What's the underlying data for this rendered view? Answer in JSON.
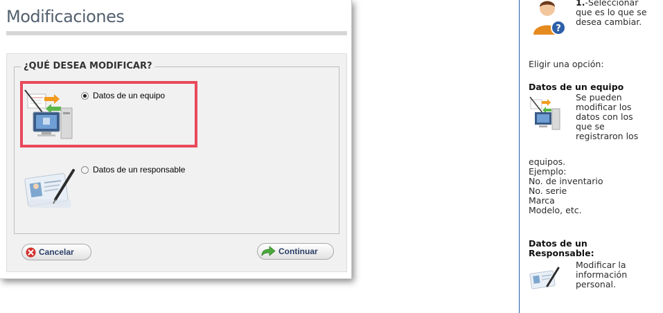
{
  "dialog": {
    "title": "Modificaciones",
    "question": "¿QUÉ DESEA MODIFICAR?",
    "options": [
      {
        "label": "Datos de un equipo",
        "selected": true
      },
      {
        "label": "Datos de un responsable",
        "selected": false
      }
    ],
    "cancel_label": "Cancelar",
    "continue_label": "Continuar",
    "highlight_color": "#e8495a"
  },
  "help": {
    "step_number": "1.",
    "step_lines": [
      "-Seleccionar",
      "que es lo que se",
      "desea cambiar."
    ],
    "choose_option": "Eligir una opción:",
    "section1": {
      "title": "Datos de un equipo",
      "lines_beside_icon": [
        "Se pueden",
        "modificar los",
        "datos con los",
        "que se",
        "registraron los"
      ],
      "lines_below": [
        "equipos.",
        "Ejemplo:",
        "No. de inventario",
        "No. serie",
        "Marca",
        "Modelo, etc."
      ]
    },
    "section2": {
      "title_lines": [
        "Datos de un",
        "Responsable:"
      ],
      "lines": [
        "Modificar la",
        "información",
        "personal."
      ]
    }
  },
  "icons": {
    "cancel": "close-circle-icon",
    "continue": "green-arrow-icon",
    "equipment": "computer-transfer-icon",
    "responsible": "id-card-pen-icon",
    "help_user": "user-question-icon"
  }
}
